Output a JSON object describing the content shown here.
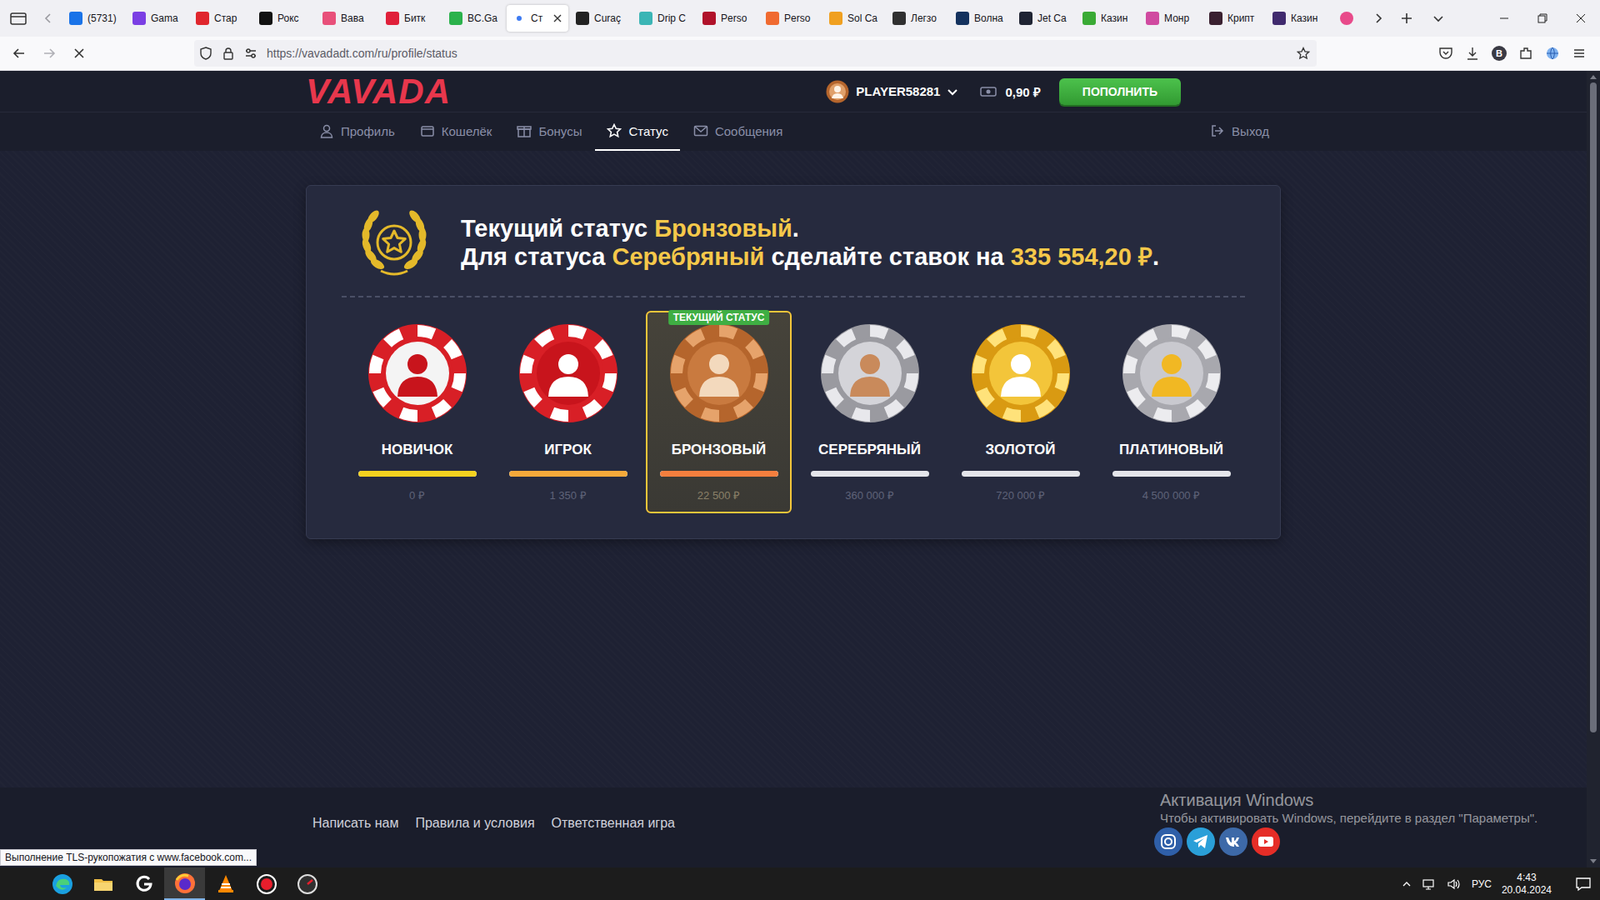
{
  "browser": {
    "tabs": [
      {
        "label": "(5731)",
        "selected": false,
        "loading": false,
        "color": "#1a73e8"
      },
      {
        "label": "Gama",
        "selected": false,
        "loading": false,
        "color": "#7b3fe4"
      },
      {
        "label": "Стар",
        "selected": false,
        "loading": false,
        "color": "#e0262d"
      },
      {
        "label": "Рокс",
        "selected": false,
        "loading": false,
        "color": "#111111"
      },
      {
        "label": "Вава",
        "selected": false,
        "loading": false,
        "color": "#e8507a"
      },
      {
        "label": "Битк",
        "selected": false,
        "loading": false,
        "color": "#e0203a"
      },
      {
        "label": "BC.Ga",
        "selected": false,
        "loading": false,
        "color": "#2bb24c"
      },
      {
        "label": "Ст",
        "selected": true,
        "loading": true,
        "color": "#3d7bf2"
      },
      {
        "label": "Curaç",
        "selected": false,
        "loading": false,
        "color": "#222222"
      },
      {
        "label": "Drip C",
        "selected": false,
        "loading": false,
        "color": "#3bb5b5"
      },
      {
        "label": "Perso",
        "selected": false,
        "loading": false,
        "color": "#b0122a"
      },
      {
        "label": "Perso",
        "selected": false,
        "loading": false,
        "color": "#f06a30"
      },
      {
        "label": "Sol Ca",
        "selected": false,
        "loading": false,
        "color": "#f0a020"
      },
      {
        "label": "Легзо",
        "selected": false,
        "loading": false,
        "color": "#303030"
      },
      {
        "label": "Волна",
        "selected": false,
        "loading": false,
        "color": "#14325e"
      },
      {
        "label": "Jet Ca",
        "selected": false,
        "loading": false,
        "color": "#1f2433"
      },
      {
        "label": "Казин",
        "selected": false,
        "loading": false,
        "color": "#3aaa35"
      },
      {
        "label": "Монр",
        "selected": false,
        "loading": false,
        "color": "#d04aa0"
      },
      {
        "label": "Крипт",
        "selected": false,
        "loading": false,
        "color": "#3a2030"
      },
      {
        "label": "Казин",
        "selected": false,
        "loading": false,
        "color": "#402a6e"
      }
    ],
    "overflow_tab": {
      "color": "#e84a8a"
    },
    "address_bar": {
      "url": "https://vavadadt.com/ru/profile/status"
    },
    "profile_letter": "B",
    "status_tooltip": "Выполнение TLS-рукопожатия с www.facebook.com...",
    "scrollbar": {
      "level": 0.84
    }
  },
  "site": {
    "logo": "VAVADA",
    "user": {
      "name": "PLAYER58281"
    },
    "balance": "0,90 ₽",
    "deposit_button": "ПОПОЛНИТЬ",
    "nav": [
      {
        "label": "Профиль",
        "selected": false,
        "kind": "profile"
      },
      {
        "label": "Кошелёк",
        "selected": false,
        "kind": "wallet"
      },
      {
        "label": "Бонусы",
        "selected": false,
        "kind": "gift"
      },
      {
        "label": "Статус",
        "selected": true,
        "kind": "star"
      },
      {
        "label": "Сообщения",
        "selected": false,
        "kind": "mail"
      }
    ],
    "logout": "Выход",
    "status_card": {
      "heading": [
        [
          {
            "text": "Текущий статус ",
            "highlight": false
          },
          {
            "text": "Бронзовый",
            "highlight": true
          },
          {
            "text": ".",
            "highlight": false
          }
        ],
        [
          {
            "text": "Для статуса ",
            "highlight": false
          },
          {
            "text": "Серебряный",
            "highlight": true
          },
          {
            "text": " сделайте ставок на ",
            "highlight": false
          },
          {
            "text": "335 554,20 ₽",
            "highlight": true
          },
          {
            "text": ".",
            "highlight": false
          }
        ]
      ],
      "current_badge": "ТЕКУЩИЙ СТАТУС",
      "levels": [
        {
          "name": "НОВИЧОК",
          "threshold": "0 ₽",
          "level": 1,
          "color": "#f4d21f",
          "kind": "novice",
          "selected": false
        },
        {
          "name": "ИГРОК",
          "threshold": "1 350 ₽",
          "level": 1,
          "color": "#f5a93a",
          "kind": "player",
          "selected": false
        },
        {
          "name": "БРОНЗОВЫЙ",
          "threshold": "22 500 ₽",
          "level": 1,
          "color": "#f47f3e",
          "kind": "bronze",
          "selected": true
        },
        {
          "name": "СЕРЕБРЯНЫЙ",
          "threshold": "360 000 ₽",
          "level": 0,
          "color": "#c0c0c8",
          "kind": "silver",
          "selected": false
        },
        {
          "name": "ЗОЛОТОЙ",
          "threshold": "720 000 ₽",
          "level": 0,
          "color": "#f3c53a",
          "kind": "gold",
          "selected": false
        },
        {
          "name": "ПЛАТИНОВЫЙ",
          "threshold": "4 500 000 ₽",
          "level": 0,
          "color": "#b4b4b8",
          "kind": "platinum",
          "selected": false
        }
      ]
    },
    "footer": {
      "links": [
        "Написать нам",
        "Правила и условия",
        "Ответственная игра"
      ]
    }
  },
  "windows": {
    "watermark": {
      "title": "Активация Windows",
      "text": "Чтобы активировать Windows, перейдите в раздел \"Параметры\"."
    },
    "taskbar": {
      "language": "РУС",
      "time": "4:43",
      "date": "20.04.2024"
    }
  }
}
